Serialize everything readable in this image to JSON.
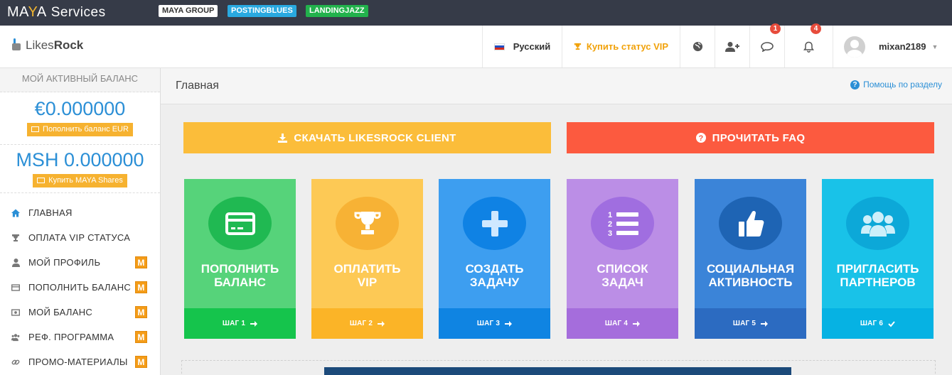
{
  "topbar": {
    "logo_main": "MAYA",
    "logo_services": "Services",
    "links": [
      "MAYA GROUP",
      "POSTINGBLUES",
      "LANDINGJAZZ"
    ]
  },
  "header": {
    "brand_light": "Likes",
    "brand_bold": "Rock",
    "language": "Русский",
    "vip_label": "Купить статус VIP",
    "chat_count": "1",
    "bell_count": "4",
    "username": "mixan2189",
    "icons": [
      "globe-icon",
      "add-user-icon",
      "chat-icon",
      "bell-icon"
    ]
  },
  "sidebar": {
    "balance_title": "МОЙ АКТИВНЫЙ БАЛАНС",
    "eur_amount": "€0.000000",
    "eur_button": "Пополнить баланс EUR",
    "msh_amount": "MSH 0.000000",
    "msh_button": "Купить MAYA Shares",
    "items": [
      {
        "label": "ГЛАВНАЯ",
        "icon": "home-icon",
        "badge": ""
      },
      {
        "label": "ОПЛАТА VIP СТАТУСА",
        "icon": "trophy-icon",
        "badge": ""
      },
      {
        "label": "МОЙ ПРОФИЛЬ",
        "icon": "user-icon",
        "badge": "M"
      },
      {
        "label": "ПОПОЛНИТЬ БАЛАНС",
        "icon": "credit-card-icon",
        "badge": "M"
      },
      {
        "label": "МОЙ БАЛАНС",
        "icon": "money-icon",
        "badge": "M"
      },
      {
        "label": "РЕФ. ПРОГРАММА",
        "icon": "users-icon",
        "badge": "M"
      },
      {
        "label": "ПРОМО-МАТЕРИАЛЫ",
        "icon": "link-icon",
        "badge": "M"
      }
    ]
  },
  "main": {
    "page_title": "Главная",
    "help_label": "Помощь по разделу",
    "download_label": "СКАЧАТЬ LIKESROCK CLIENT",
    "faq_label": "ПРОЧИТАТЬ FAQ",
    "tiles": [
      {
        "line1": "ПОПОЛНИТЬ",
        "line2": "БАЛАНС",
        "step": "ШАГ 1",
        "icon": "credit-card-icon"
      },
      {
        "line1": "ОПЛАТИТЬ",
        "line2": "VIP",
        "step": "ШАГ 2",
        "icon": "trophy-icon"
      },
      {
        "line1": "СОЗДАТЬ",
        "line2": "ЗАДАЧУ",
        "step": "ШАГ 3",
        "icon": "plus-icon"
      },
      {
        "line1": "СПИСОК",
        "line2": "ЗАДАЧ",
        "step": "ШАГ 4",
        "icon": "numbered-list-icon"
      },
      {
        "line1": "СОЦИАЛЬНАЯ",
        "line2": "АКТИВНОСТЬ",
        "step": "ШАГ 5",
        "icon": "thumbs-up-icon"
      },
      {
        "line1": "ПРИГЛАСИТЬ",
        "line2": "ПАРТНЕРОВ",
        "step": "ШАГ 6",
        "icon": "users-icon"
      }
    ]
  },
  "colors": {
    "topbar": "#363b48",
    "accent_blue": "#2b8fd6",
    "orange": "#fbbd3a",
    "red": "#fc5a3f"
  }
}
